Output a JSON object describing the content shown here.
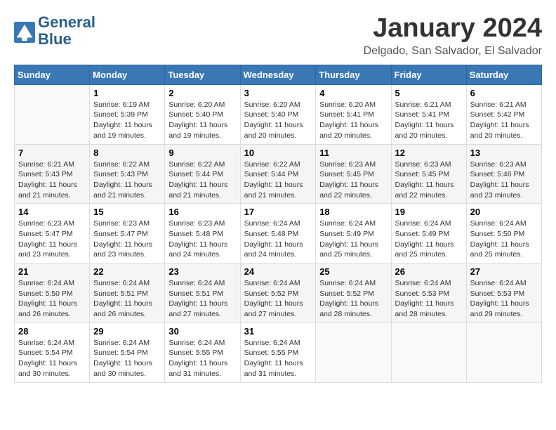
{
  "header": {
    "logo_line1": "General",
    "logo_line2": "Blue",
    "month_title": "January 2024",
    "location": "Delgado, San Salvador, El Salvador"
  },
  "weekdays": [
    "Sunday",
    "Monday",
    "Tuesday",
    "Wednesday",
    "Thursday",
    "Friday",
    "Saturday"
  ],
  "weeks": [
    [
      {
        "day": "",
        "info": ""
      },
      {
        "day": "1",
        "info": "Sunrise: 6:19 AM\nSunset: 5:39 PM\nDaylight: 11 hours\nand 19 minutes."
      },
      {
        "day": "2",
        "info": "Sunrise: 6:20 AM\nSunset: 5:40 PM\nDaylight: 11 hours\nand 19 minutes."
      },
      {
        "day": "3",
        "info": "Sunrise: 6:20 AM\nSunset: 5:40 PM\nDaylight: 11 hours\nand 20 minutes."
      },
      {
        "day": "4",
        "info": "Sunrise: 6:20 AM\nSunset: 5:41 PM\nDaylight: 11 hours\nand 20 minutes."
      },
      {
        "day": "5",
        "info": "Sunrise: 6:21 AM\nSunset: 5:41 PM\nDaylight: 11 hours\nand 20 minutes."
      },
      {
        "day": "6",
        "info": "Sunrise: 6:21 AM\nSunset: 5:42 PM\nDaylight: 11 hours\nand 20 minutes."
      }
    ],
    [
      {
        "day": "7",
        "info": "Sunrise: 6:21 AM\nSunset: 5:43 PM\nDaylight: 11 hours\nand 21 minutes."
      },
      {
        "day": "8",
        "info": "Sunrise: 6:22 AM\nSunset: 5:43 PM\nDaylight: 11 hours\nand 21 minutes."
      },
      {
        "day": "9",
        "info": "Sunrise: 6:22 AM\nSunset: 5:44 PM\nDaylight: 11 hours\nand 21 minutes."
      },
      {
        "day": "10",
        "info": "Sunrise: 6:22 AM\nSunset: 5:44 PM\nDaylight: 11 hours\nand 21 minutes."
      },
      {
        "day": "11",
        "info": "Sunrise: 6:23 AM\nSunset: 5:45 PM\nDaylight: 11 hours\nand 22 minutes."
      },
      {
        "day": "12",
        "info": "Sunrise: 6:23 AM\nSunset: 5:45 PM\nDaylight: 11 hours\nand 22 minutes."
      },
      {
        "day": "13",
        "info": "Sunrise: 6:23 AM\nSunset: 5:46 PM\nDaylight: 11 hours\nand 23 minutes."
      }
    ],
    [
      {
        "day": "14",
        "info": "Sunrise: 6:23 AM\nSunset: 5:47 PM\nDaylight: 11 hours\nand 23 minutes."
      },
      {
        "day": "15",
        "info": "Sunrise: 6:23 AM\nSunset: 5:47 PM\nDaylight: 11 hours\nand 23 minutes."
      },
      {
        "day": "16",
        "info": "Sunrise: 6:23 AM\nSunset: 5:48 PM\nDaylight: 11 hours\nand 24 minutes."
      },
      {
        "day": "17",
        "info": "Sunrise: 6:24 AM\nSunset: 5:48 PM\nDaylight: 11 hours\nand 24 minutes."
      },
      {
        "day": "18",
        "info": "Sunrise: 6:24 AM\nSunset: 5:49 PM\nDaylight: 11 hours\nand 25 minutes."
      },
      {
        "day": "19",
        "info": "Sunrise: 6:24 AM\nSunset: 5:49 PM\nDaylight: 11 hours\nand 25 minutes."
      },
      {
        "day": "20",
        "info": "Sunrise: 6:24 AM\nSunset: 5:50 PM\nDaylight: 11 hours\nand 25 minutes."
      }
    ],
    [
      {
        "day": "21",
        "info": "Sunrise: 6:24 AM\nSunset: 5:50 PM\nDaylight: 11 hours\nand 26 minutes."
      },
      {
        "day": "22",
        "info": "Sunrise: 6:24 AM\nSunset: 5:51 PM\nDaylight: 11 hours\nand 26 minutes."
      },
      {
        "day": "23",
        "info": "Sunrise: 6:24 AM\nSunset: 5:51 PM\nDaylight: 11 hours\nand 27 minutes."
      },
      {
        "day": "24",
        "info": "Sunrise: 6:24 AM\nSunset: 5:52 PM\nDaylight: 11 hours\nand 27 minutes."
      },
      {
        "day": "25",
        "info": "Sunrise: 6:24 AM\nSunset: 5:52 PM\nDaylight: 11 hours\nand 28 minutes."
      },
      {
        "day": "26",
        "info": "Sunrise: 6:24 AM\nSunset: 5:53 PM\nDaylight: 11 hours\nand 28 minutes."
      },
      {
        "day": "27",
        "info": "Sunrise: 6:24 AM\nSunset: 5:53 PM\nDaylight: 11 hours\nand 29 minutes."
      }
    ],
    [
      {
        "day": "28",
        "info": "Sunrise: 6:24 AM\nSunset: 5:54 PM\nDaylight: 11 hours\nand 30 minutes."
      },
      {
        "day": "29",
        "info": "Sunrise: 6:24 AM\nSunset: 5:54 PM\nDaylight: 11 hours\nand 30 minutes."
      },
      {
        "day": "30",
        "info": "Sunrise: 6:24 AM\nSunset: 5:55 PM\nDaylight: 11 hours\nand 31 minutes."
      },
      {
        "day": "31",
        "info": "Sunrise: 6:24 AM\nSunset: 5:55 PM\nDaylight: 11 hours\nand 31 minutes."
      },
      {
        "day": "",
        "info": ""
      },
      {
        "day": "",
        "info": ""
      },
      {
        "day": "",
        "info": ""
      }
    ]
  ]
}
